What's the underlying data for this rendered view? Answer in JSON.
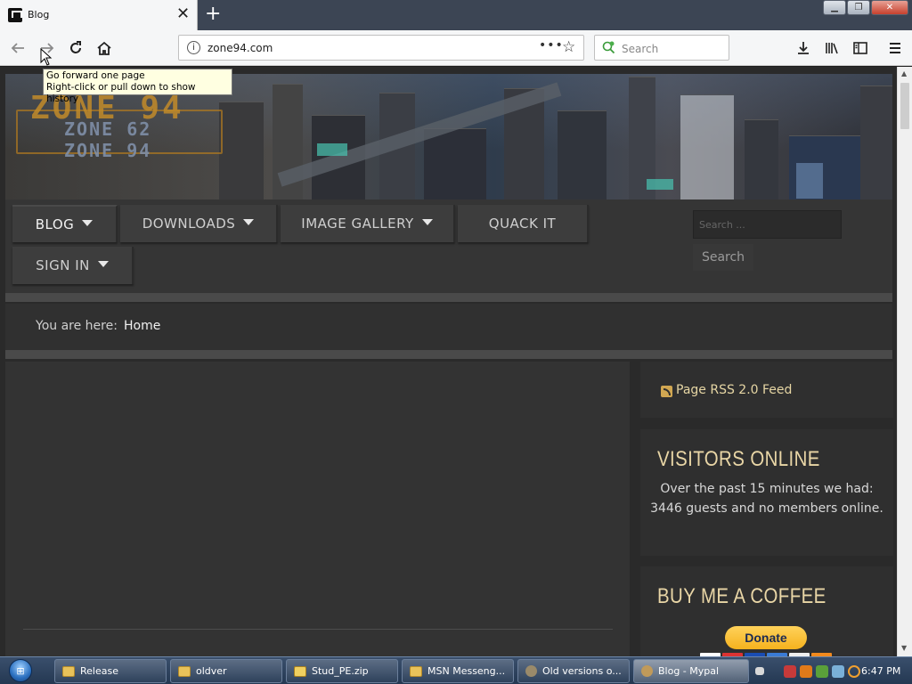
{
  "browser": {
    "tab_title": "Blog",
    "tab_close": "✕",
    "new_tab": "+",
    "url": "zone94.com",
    "url_more": "•••",
    "search_placeholder": "Search",
    "tooltip_line1": "Go forward one page",
    "tooltip_line2": "Right-click or pull down to show history"
  },
  "site": {
    "logo_big": "ZONE 94",
    "logo_small_1": "ZONE 62",
    "logo_small_2": "ZONE 94",
    "menu": [
      {
        "label": "BLOG",
        "has_dropdown": true,
        "active": true
      },
      {
        "label": "DOWNLOADS",
        "has_dropdown": true
      },
      {
        "label": "IMAGE GALLERY",
        "has_dropdown": true
      },
      {
        "label": "QUACK IT",
        "has_dropdown": false
      },
      {
        "label": "SIGN IN",
        "has_dropdown": true
      }
    ],
    "search_placeholder": "Search ...",
    "search_button": "Search",
    "breadcrumb_label": "You are here:",
    "breadcrumb_home": "Home"
  },
  "sidebar": {
    "rss_link": "Page RSS 2.0 Feed",
    "visitors_heading": "VISITORS ONLINE",
    "visitors_text": "Over the past 15 minutes we had: 3446 guests and no members online.",
    "coffee_heading": "BUY ME A COFFEE",
    "donate_label": "Donate"
  },
  "taskbar": {
    "tasks": [
      {
        "label": "Release",
        "icon": "folder-icon"
      },
      {
        "label": "oldver",
        "icon": "folder-icon"
      },
      {
        "label": "Stud_PE.zip",
        "icon": "zip-icon"
      },
      {
        "label": "MSN Messeng...",
        "icon": "folder-icon"
      },
      {
        "label": "Old versions o...",
        "icon": "gear-icon"
      },
      {
        "label": "Blog - Mypal",
        "icon": "mypal-icon",
        "active": true
      }
    ],
    "clock": "6:47 PM"
  },
  "colors": {
    "heading_gold": "#e9d6a6",
    "page_bg": "#2a2a2a",
    "donate_yellow": "#ffc439"
  }
}
